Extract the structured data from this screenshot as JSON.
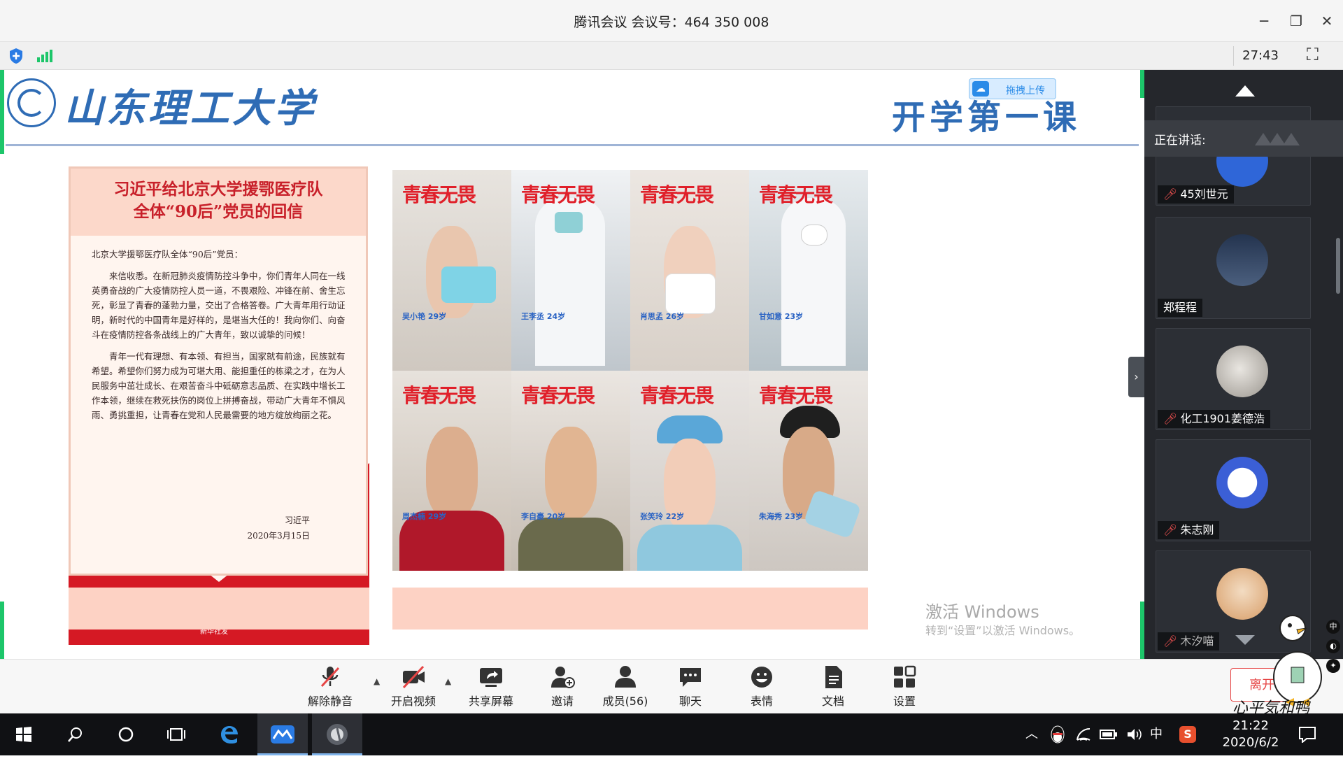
{
  "window": {
    "title": "腾讯会议 会议号：464 350 008",
    "minimize_glyph": "─",
    "restore_glyph": "❐",
    "close_glyph": "✕"
  },
  "strip": {
    "timer": "27:43",
    "shield_icon": "shield-icon",
    "signal_icon": "signal-icon",
    "fullscreen_glyph": "⛶"
  },
  "slide": {
    "university_name": "山东理工大学",
    "course_title": "开学第一课",
    "upload_label": "拖拽上传",
    "letter": {
      "title_line1": "习近平给北京大学援鄂医疗队",
      "title_line2": "全体“90后”党员的回信",
      "salutation": "北京大学援鄂医疗队全体“90后”党员：",
      "para1": "来信收悉。在新冠肺炎疫情防控斗争中，你们青年人同在一线英勇奋战的广大疫情防控人员一道，不畏艰险、冲锋在前、舍生忘死，彰显了青春的蓬勃力量，交出了合格答卷。广大青年用行动证明，新时代的中国青年是好样的，是堪当大任的！我向你们、向奋斗在疫情防控各条战线上的广大青年，致以诚挚的问候！",
      "para2": "青年一代有理想、有本领、有担当，国家就有前途，民族就有希望。希望你们努力成为可堪大用、能担重任的栋梁之才，在为人民服务中茁壮成长、在艰苦奋斗中砥砺意志品质、在实践中增长工作本领，继续在救死扶伤的岗位上拼搏奋战，带动广大青年不惧风雨、勇挑重担，让青春在党和人民最需要的地方绽放绚丽之花。",
      "signature": "习近平",
      "date": "2020年3月15日",
      "stamp": "新华社发"
    },
    "posters": [
      {
        "title": "青春无畏",
        "caption": "吴小艳 29岁"
      },
      {
        "title": "青春无畏",
        "caption": "王李丞 24岁"
      },
      {
        "title": "青春无畏",
        "caption": "肖思孟 26岁"
      },
      {
        "title": "青春无畏",
        "caption": "甘如意 23岁"
      },
      {
        "title": "青春无畏",
        "caption": "周杰楠 29岁"
      },
      {
        "title": "青春无畏",
        "caption": "李自豪 20岁"
      },
      {
        "title": "青春无畏",
        "caption": "张笑玲 22岁"
      },
      {
        "title": "青春无畏",
        "caption": "朱海秀 23岁"
      }
    ],
    "activate_windows": "激活 Windows",
    "activate_windows_hint": "转到“设置”以激活 Windows。",
    "side_handle_glyph": "›"
  },
  "panel": {
    "speaking_label": "正在讲话:",
    "participants": [
      {
        "name": "45刘世元",
        "muted": true
      },
      {
        "name": "郑程程",
        "muted": false
      },
      {
        "name": "化工1901姜德浩",
        "muted": true
      },
      {
        "name": "朱志刚",
        "muted": true
      },
      {
        "name": "木汐喵",
        "muted": true
      }
    ]
  },
  "controls": {
    "unmute": "解除静音",
    "video": "开启视频",
    "share": "共享屏幕",
    "invite": "邀请",
    "members": "成员(56)",
    "chat": "聊天",
    "emoji": "表情",
    "docs": "文档",
    "settings": "设置",
    "leave": "离开会",
    "signature_overlay": "心平気和鸭"
  },
  "taskbar": {
    "ime": "中",
    "time": "21:22",
    "date": "2020/6/2"
  },
  "colors": {
    "brand_blue": "#2f6cb5",
    "poster_red": "#e0202a",
    "accent_green": "#1dc66a",
    "danger": "#e64545"
  }
}
